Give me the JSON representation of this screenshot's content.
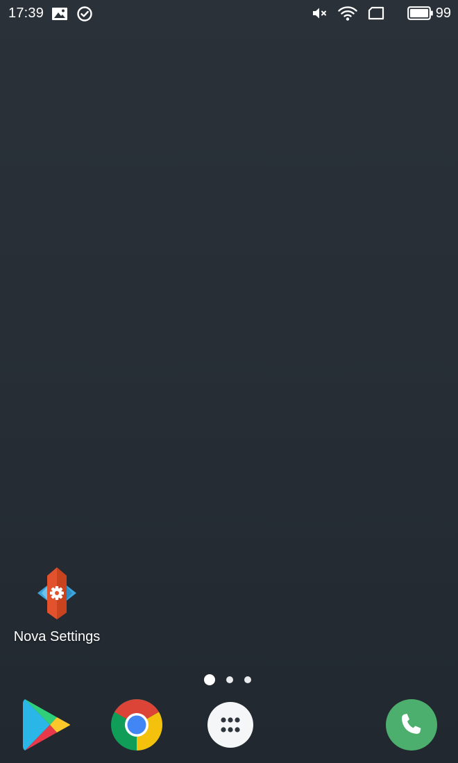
{
  "status_bar": {
    "time": "17:39",
    "left_icons": [
      "gallery-notification-icon",
      "check-circle-icon"
    ],
    "right_icons": [
      "volume-muted-icon",
      "wifi-icon",
      "no-sim-icon",
      "battery-icon"
    ],
    "battery_level": "99"
  },
  "home_screen": {
    "apps": [
      {
        "label": "Nova Settings",
        "icon": "nova-settings-icon"
      }
    ],
    "page_indicator": {
      "pages": 3,
      "active_page": 1
    }
  },
  "dock": {
    "items": [
      {
        "name": "play-store-icon"
      },
      {
        "name": "chrome-icon"
      },
      {
        "name": "app-drawer-icon"
      },
      {
        "name": "phone-icon"
      }
    ]
  },
  "colors": {
    "wallpaper": "#262d35",
    "nova_red": "#e2522c",
    "nova_blue": "#3ba4dc",
    "phone_green": "#4caf6d",
    "chrome_red": "#db4437",
    "chrome_yellow": "#f4c20d",
    "chrome_green": "#0f9d58",
    "chrome_blue": "#4285f4"
  }
}
